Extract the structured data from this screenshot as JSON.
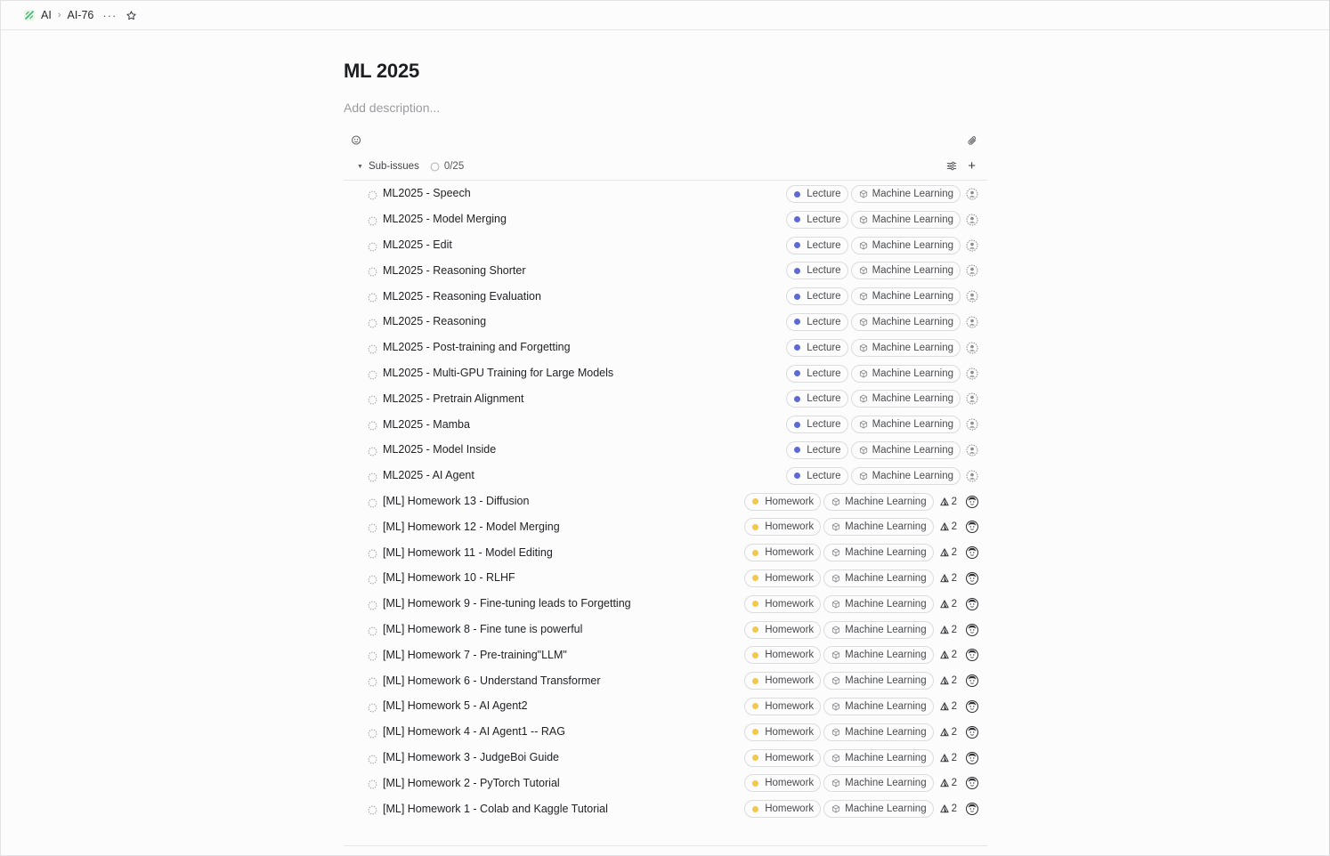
{
  "breadcrumb": {
    "team": "AI",
    "issue_id": "AI-76",
    "more_label": "···"
  },
  "issue": {
    "title": "ML 2025",
    "description_placeholder": "Add description..."
  },
  "sub_issues": {
    "label": "Sub-issues",
    "progress": "0/25",
    "items": [
      {
        "title": "ML2025 - Speech",
        "label": "Lecture",
        "label_color": "#5e6ad2",
        "project": "Machine Learning",
        "estimate": null
      },
      {
        "title": "ML2025 - Model Merging",
        "label": "Lecture",
        "label_color": "#5e6ad2",
        "project": "Machine Learning",
        "estimate": null
      },
      {
        "title": "ML2025 - Edit",
        "label": "Lecture",
        "label_color": "#5e6ad2",
        "project": "Machine Learning",
        "estimate": null
      },
      {
        "title": "ML2025 - Reasoning Shorter",
        "label": "Lecture",
        "label_color": "#5e6ad2",
        "project": "Machine Learning",
        "estimate": null
      },
      {
        "title": "ML2025 - Reasoning Evaluation",
        "label": "Lecture",
        "label_color": "#5e6ad2",
        "project": "Machine Learning",
        "estimate": null
      },
      {
        "title": "ML2025 - Reasoning",
        "label": "Lecture",
        "label_color": "#5e6ad2",
        "project": "Machine Learning",
        "estimate": null
      },
      {
        "title": "ML2025 - Post-training and Forgetting",
        "label": "Lecture",
        "label_color": "#5e6ad2",
        "project": "Machine Learning",
        "estimate": null
      },
      {
        "title": "ML2025 - Multi-GPU Training for Large Models",
        "label": "Lecture",
        "label_color": "#5e6ad2",
        "project": "Machine Learning",
        "estimate": null
      },
      {
        "title": "ML2025 - Pretrain Alignment",
        "label": "Lecture",
        "label_color": "#5e6ad2",
        "project": "Machine Learning",
        "estimate": null
      },
      {
        "title": "ML2025 - Mamba",
        "label": "Lecture",
        "label_color": "#5e6ad2",
        "project": "Machine Learning",
        "estimate": null
      },
      {
        "title": "ML2025 - Model Inside",
        "label": "Lecture",
        "label_color": "#5e6ad2",
        "project": "Machine Learning",
        "estimate": null
      },
      {
        "title": "ML2025 - AI Agent",
        "label": "Lecture",
        "label_color": "#5e6ad2",
        "project": "Machine Learning",
        "estimate": null
      },
      {
        "title": "[ML] Homework 13 - Diffusion",
        "label": "Homework",
        "label_color": "#f2c94c",
        "project": "Machine Learning",
        "estimate": "2"
      },
      {
        "title": "[ML] Homework 12 - Model Merging",
        "label": "Homework",
        "label_color": "#f2c94c",
        "project": "Machine Learning",
        "estimate": "2"
      },
      {
        "title": "[ML] Homework 11 - Model Editing",
        "label": "Homework",
        "label_color": "#f2c94c",
        "project": "Machine Learning",
        "estimate": "2"
      },
      {
        "title": "[ML] Homework 10 - RLHF",
        "label": "Homework",
        "label_color": "#f2c94c",
        "project": "Machine Learning",
        "estimate": "2"
      },
      {
        "title": "[ML] Homework 9 - Fine-tuning leads to Forgetting",
        "label": "Homework",
        "label_color": "#f2c94c",
        "project": "Machine Learning",
        "estimate": "2"
      },
      {
        "title": "[ML] Homework 8 - Fine tune is powerful",
        "label": "Homework",
        "label_color": "#f2c94c",
        "project": "Machine Learning",
        "estimate": "2"
      },
      {
        "title": "[ML] Homework 7 - Pre-training\"LLM\"",
        "label": "Homework",
        "label_color": "#f2c94c",
        "project": "Machine Learning",
        "estimate": "2"
      },
      {
        "title": "[ML] Homework 6 - Understand Transformer",
        "label": "Homework",
        "label_color": "#f2c94c",
        "project": "Machine Learning",
        "estimate": "2"
      },
      {
        "title": "[ML] Homework 5 - AI Agent2",
        "label": "Homework",
        "label_color": "#f2c94c",
        "project": "Machine Learning",
        "estimate": "2"
      },
      {
        "title": "[ML] Homework 4 - AI Agent1 -- RAG",
        "label": "Homework",
        "label_color": "#f2c94c",
        "project": "Machine Learning",
        "estimate": "2"
      },
      {
        "title": "[ML] Homework 3 - JudgeBoi Guide",
        "label": "Homework",
        "label_color": "#f2c94c",
        "project": "Machine Learning",
        "estimate": "2"
      },
      {
        "title": "[ML] Homework 2 - PyTorch Tutorial",
        "label": "Homework",
        "label_color": "#f2c94c",
        "project": "Machine Learning",
        "estimate": "2"
      },
      {
        "title": "[ML] Homework 1 - Colab and Kaggle Tutorial",
        "label": "Homework",
        "label_color": "#f2c94c",
        "project": "Machine Learning",
        "estimate": "2"
      }
    ]
  }
}
